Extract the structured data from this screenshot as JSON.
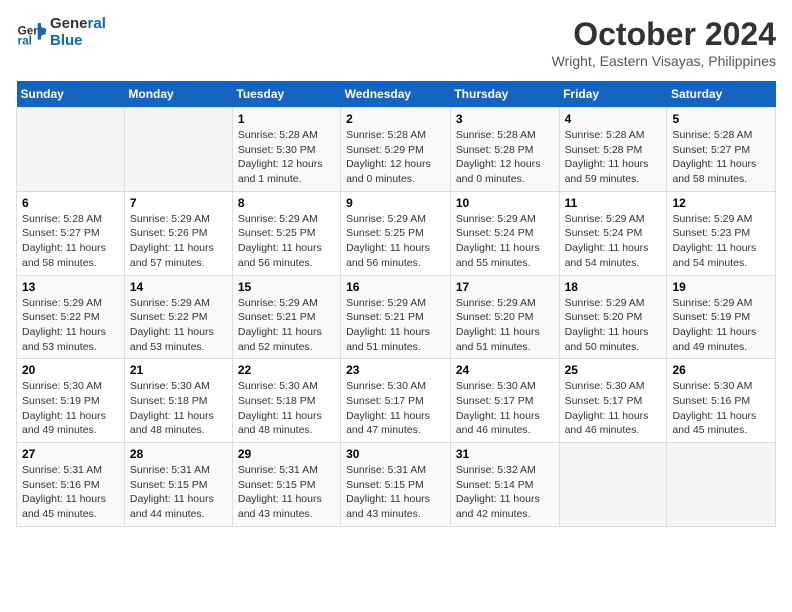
{
  "header": {
    "logo_line1": "General",
    "logo_line2": "Blue",
    "month": "October 2024",
    "location": "Wright, Eastern Visayas, Philippines"
  },
  "weekdays": [
    "Sunday",
    "Monday",
    "Tuesday",
    "Wednesday",
    "Thursday",
    "Friday",
    "Saturday"
  ],
  "weeks": [
    [
      {
        "day": "",
        "content": ""
      },
      {
        "day": "",
        "content": ""
      },
      {
        "day": "1",
        "sunrise": "5:28 AM",
        "sunset": "5:30 PM",
        "daylight": "12 hours and 1 minute."
      },
      {
        "day": "2",
        "sunrise": "5:28 AM",
        "sunset": "5:29 PM",
        "daylight": "12 hours and 0 minutes."
      },
      {
        "day": "3",
        "sunrise": "5:28 AM",
        "sunset": "5:28 PM",
        "daylight": "12 hours and 0 minutes."
      },
      {
        "day": "4",
        "sunrise": "5:28 AM",
        "sunset": "5:28 PM",
        "daylight": "11 hours and 59 minutes."
      },
      {
        "day": "5",
        "sunrise": "5:28 AM",
        "sunset": "5:27 PM",
        "daylight": "11 hours and 58 minutes."
      }
    ],
    [
      {
        "day": "6",
        "sunrise": "5:28 AM",
        "sunset": "5:27 PM",
        "daylight": "11 hours and 58 minutes."
      },
      {
        "day": "7",
        "sunrise": "5:29 AM",
        "sunset": "5:26 PM",
        "daylight": "11 hours and 57 minutes."
      },
      {
        "day": "8",
        "sunrise": "5:29 AM",
        "sunset": "5:25 PM",
        "daylight": "11 hours and 56 minutes."
      },
      {
        "day": "9",
        "sunrise": "5:29 AM",
        "sunset": "5:25 PM",
        "daylight": "11 hours and 56 minutes."
      },
      {
        "day": "10",
        "sunrise": "5:29 AM",
        "sunset": "5:24 PM",
        "daylight": "11 hours and 55 minutes."
      },
      {
        "day": "11",
        "sunrise": "5:29 AM",
        "sunset": "5:24 PM",
        "daylight": "11 hours and 54 minutes."
      },
      {
        "day": "12",
        "sunrise": "5:29 AM",
        "sunset": "5:23 PM",
        "daylight": "11 hours and 54 minutes."
      }
    ],
    [
      {
        "day": "13",
        "sunrise": "5:29 AM",
        "sunset": "5:22 PM",
        "daylight": "11 hours and 53 minutes."
      },
      {
        "day": "14",
        "sunrise": "5:29 AM",
        "sunset": "5:22 PM",
        "daylight": "11 hours and 53 minutes."
      },
      {
        "day": "15",
        "sunrise": "5:29 AM",
        "sunset": "5:21 PM",
        "daylight": "11 hours and 52 minutes."
      },
      {
        "day": "16",
        "sunrise": "5:29 AM",
        "sunset": "5:21 PM",
        "daylight": "11 hours and 51 minutes."
      },
      {
        "day": "17",
        "sunrise": "5:29 AM",
        "sunset": "5:20 PM",
        "daylight": "11 hours and 51 minutes."
      },
      {
        "day": "18",
        "sunrise": "5:29 AM",
        "sunset": "5:20 PM",
        "daylight": "11 hours and 50 minutes."
      },
      {
        "day": "19",
        "sunrise": "5:29 AM",
        "sunset": "5:19 PM",
        "daylight": "11 hours and 49 minutes."
      }
    ],
    [
      {
        "day": "20",
        "sunrise": "5:30 AM",
        "sunset": "5:19 PM",
        "daylight": "11 hours and 49 minutes."
      },
      {
        "day": "21",
        "sunrise": "5:30 AM",
        "sunset": "5:18 PM",
        "daylight": "11 hours and 48 minutes."
      },
      {
        "day": "22",
        "sunrise": "5:30 AM",
        "sunset": "5:18 PM",
        "daylight": "11 hours and 48 minutes."
      },
      {
        "day": "23",
        "sunrise": "5:30 AM",
        "sunset": "5:17 PM",
        "daylight": "11 hours and 47 minutes."
      },
      {
        "day": "24",
        "sunrise": "5:30 AM",
        "sunset": "5:17 PM",
        "daylight": "11 hours and 46 minutes."
      },
      {
        "day": "25",
        "sunrise": "5:30 AM",
        "sunset": "5:17 PM",
        "daylight": "11 hours and 46 minutes."
      },
      {
        "day": "26",
        "sunrise": "5:30 AM",
        "sunset": "5:16 PM",
        "daylight": "11 hours and 45 minutes."
      }
    ],
    [
      {
        "day": "27",
        "sunrise": "5:31 AM",
        "sunset": "5:16 PM",
        "daylight": "11 hours and 45 minutes."
      },
      {
        "day": "28",
        "sunrise": "5:31 AM",
        "sunset": "5:15 PM",
        "daylight": "11 hours and 44 minutes."
      },
      {
        "day": "29",
        "sunrise": "5:31 AM",
        "sunset": "5:15 PM",
        "daylight": "11 hours and 43 minutes."
      },
      {
        "day": "30",
        "sunrise": "5:31 AM",
        "sunset": "5:15 PM",
        "daylight": "11 hours and 43 minutes."
      },
      {
        "day": "31",
        "sunrise": "5:32 AM",
        "sunset": "5:14 PM",
        "daylight": "11 hours and 42 minutes."
      },
      {
        "day": "",
        "content": ""
      },
      {
        "day": "",
        "content": ""
      }
    ]
  ],
  "labels": {
    "sunrise_prefix": "Sunrise: ",
    "sunset_prefix": "Sunset: ",
    "daylight_prefix": "Daylight: "
  }
}
